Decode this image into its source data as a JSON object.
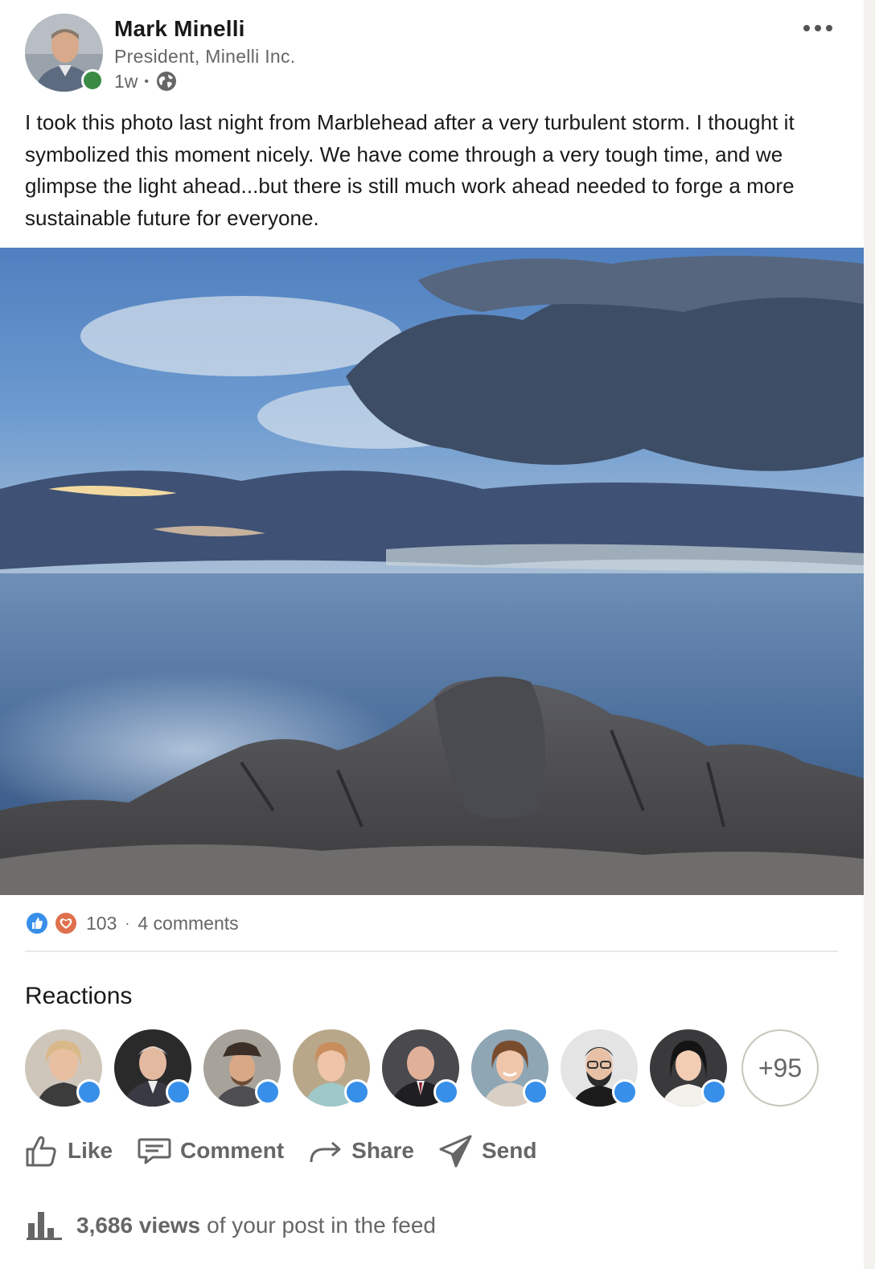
{
  "author": {
    "name": "Mark Minelli",
    "title": "President, Minelli Inc.",
    "time_ago": "1w",
    "separator": "•",
    "visibility_icon": "globe-icon",
    "presence_color": "#3a8a44"
  },
  "post": {
    "text": "I took this photo last night from Marblehead after a very turbulent storm. I thought it symbolized this moment nicely. We have come through a very tough time, and we glimpse the light ahead...but there is still much work ahead needed to forge a more sustainable future for everyone."
  },
  "social": {
    "reaction_count": "103",
    "separator": "·",
    "comments": "4 comments",
    "reaction_icons": [
      "like-icon",
      "love-icon"
    ]
  },
  "reactions": {
    "title": "Reactions",
    "people_shown": 8,
    "more_label": "+95"
  },
  "actions": {
    "like": "Like",
    "comment": "Comment",
    "share": "Share",
    "send": "Send"
  },
  "views": {
    "count": "3,686 views",
    "suffix": "of your post in the feed"
  },
  "colors": {
    "like_blue": "#378fe9",
    "love_orange": "#df704d",
    "text_muted": "#666666"
  }
}
